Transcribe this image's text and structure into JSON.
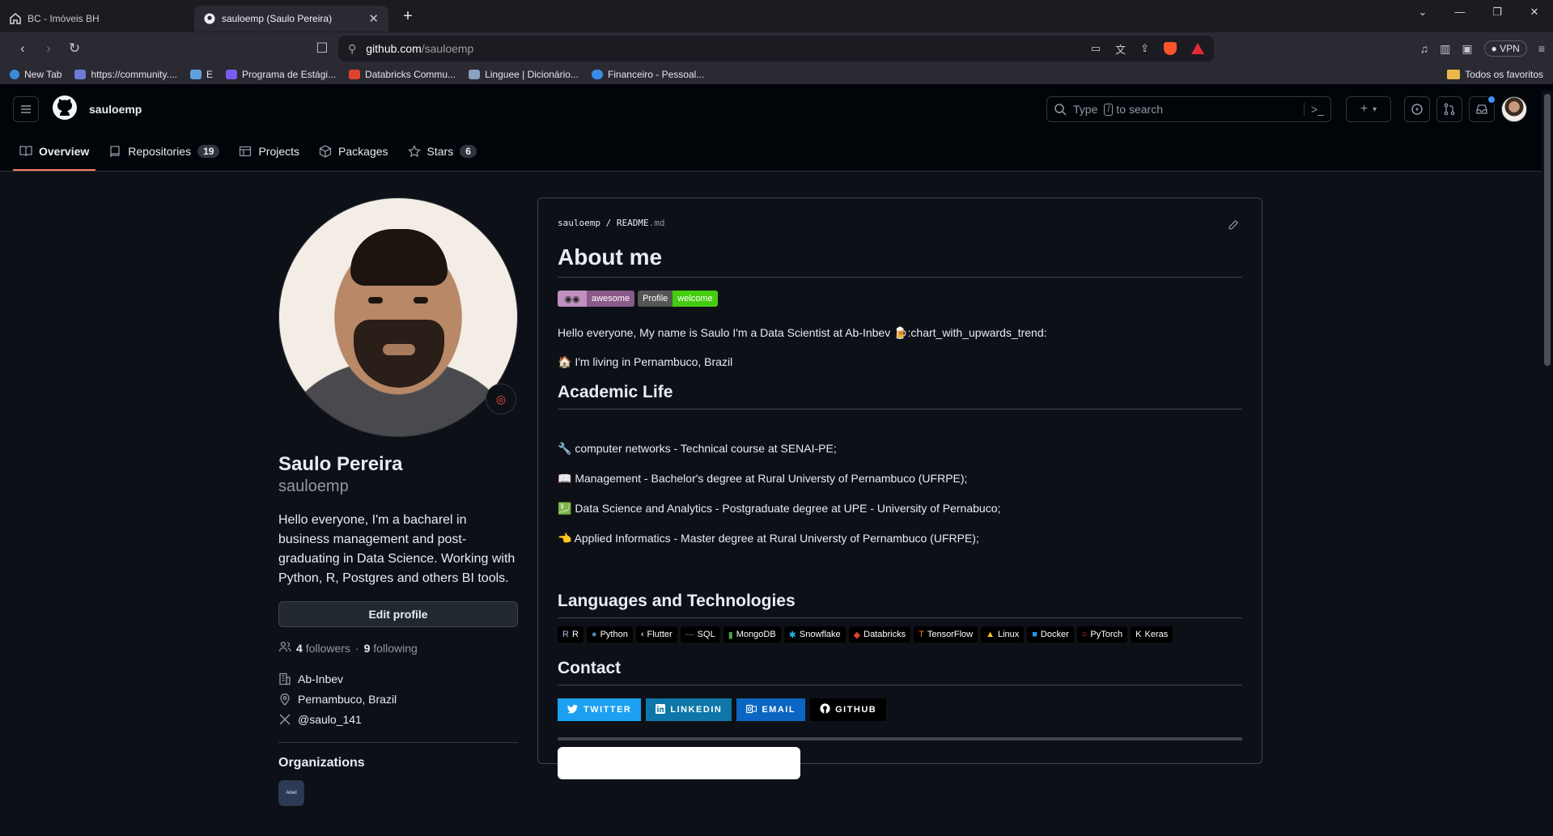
{
  "browser": {
    "tabs": [
      {
        "title": "BC - Imóveis BH",
        "active": false
      },
      {
        "title": "sauloemp (Saulo Pereira)",
        "active": true
      }
    ],
    "url_host": "github.com",
    "url_path": "/sauloemp",
    "vpn_label": "VPN",
    "bookmarks": [
      {
        "label": "New Tab",
        "color": "#3a8bd8"
      },
      {
        "label": "https://community....",
        "color": "#6b7bd6"
      },
      {
        "label": "E",
        "color": "#5fa0dc"
      },
      {
        "label": "Programa de Estági...",
        "color": "#7a5cf0"
      },
      {
        "label": "Databricks Commu...",
        "color": "#e0442f"
      },
      {
        "label": "Linguee | Dicionário...",
        "color": "#8aa0c0"
      },
      {
        "label": "Financeiro - Pessoal...",
        "color": "#3d8be8"
      }
    ],
    "bookmarks_folder": "Todos os favoritos"
  },
  "header": {
    "username": "sauloemp",
    "search_placeholder_pre": "Type",
    "search_key": "/",
    "search_placeholder_post": "to search"
  },
  "nav": {
    "tabs": [
      {
        "label": "Overview",
        "icon": "book-icon",
        "count": null,
        "active": true
      },
      {
        "label": "Repositories",
        "icon": "repo-icon",
        "count": "19",
        "active": false
      },
      {
        "label": "Projects",
        "icon": "table-icon",
        "count": null,
        "active": false
      },
      {
        "label": "Packages",
        "icon": "package-icon",
        "count": null,
        "active": false
      },
      {
        "label": "Stars",
        "icon": "star-icon",
        "count": "6",
        "active": false
      }
    ]
  },
  "profile": {
    "name": "Saulo Pereira",
    "login": "sauloemp",
    "bio": "Hello everyone, I'm a bacharel in business management and post-graduating in Data Science. Working with Python, R, Postgres and others BI tools.",
    "edit_label": "Edit profile",
    "followers": "4",
    "followers_label": "followers",
    "following": "9",
    "following_label": "following",
    "company": "Ab-Inbev",
    "location": "Pernambuco, Brazil",
    "twitter": "@saulo_141",
    "organizations_title": "Organizations",
    "org_avatar_text": "Aloel"
  },
  "readme": {
    "path_user": "sauloemp",
    "path_file": "README",
    "path_ext": ".md",
    "h1": "About me",
    "badge_awesome": "awesome",
    "badge_profile_l": "Profile",
    "badge_profile_r": "welcome",
    "intro": "Hello everyone, My name is Saulo I'm a Data Scientist at Ab-Inbev 🍺:chart_with_upwards_trend:",
    "living": "🏠 I'm living in Pernambuco, Brazil",
    "academic_title": "Academic Life",
    "academic": [
      "🔧 computer networks - Technical course at SENAI-PE;",
      "📖 Management - Bachelor's degree at Rural Universty of Pernambuco (UFRPE);",
      "💹 Data Science and Analytics - Postgraduate degree at UPE - University of Pernabuco;",
      "👈 Applied Informatics - Master degree at Rural Universty of Pernambuco (UFRPE);"
    ],
    "langs_title": "Languages and Technologies",
    "techs": [
      {
        "label": "R",
        "glyph": "R",
        "color": "#9fb8de"
      },
      {
        "label": "Python",
        "glyph": "●",
        "color": "#4b8bbe"
      },
      {
        "label": "Flutter",
        "glyph": "‹",
        "color": "#ffffff"
      },
      {
        "label": "SQL",
        "glyph": "—",
        "color": "#607080"
      },
      {
        "label": "MongoDB",
        "glyph": "▮",
        "color": "#47a248"
      },
      {
        "label": "Snowflake",
        "glyph": "✱",
        "color": "#29b5e8"
      },
      {
        "label": "Databricks",
        "glyph": "◆",
        "color": "#e0442f"
      },
      {
        "label": "TensorFlow",
        "glyph": "T",
        "color": "#ff6f00"
      },
      {
        "label": "Linux",
        "glyph": "▲",
        "color": "#fcc624"
      },
      {
        "label": "Docker",
        "glyph": "■",
        "color": "#2496ed"
      },
      {
        "label": "PyTorch",
        "glyph": "○",
        "color": "#ee4c2c"
      },
      {
        "label": "Keras",
        "glyph": "K",
        "color": "#ffffff"
      }
    ],
    "contact_title": "Contact",
    "contacts": [
      {
        "label": "TWITTER",
        "color": "#1ca0f2"
      },
      {
        "label": "LINKEDIN",
        "color": "#0e76a8"
      },
      {
        "label": "EMAIL",
        "color": "#0a66c2"
      },
      {
        "label": "GITHUB",
        "color": "#000000"
      }
    ]
  }
}
